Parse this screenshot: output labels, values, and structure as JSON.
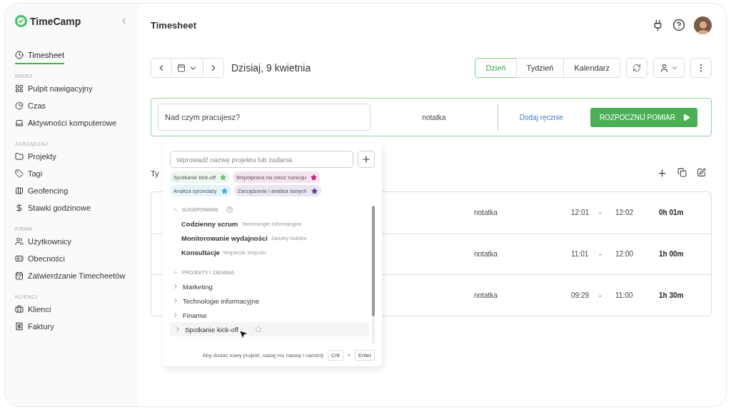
{
  "sidebar": {
    "logo": "TimeCamp",
    "nav": [
      {
        "label": "Timesheet",
        "selected": true
      }
    ],
    "groups": [
      {
        "heading": "MIERZ",
        "items": [
          {
            "label": "Pulpit nawigacyjny",
            "selected": false
          },
          {
            "label": "Czas",
            "selected": false
          },
          {
            "label": "Aktywności komputerowe",
            "selected": false
          }
        ]
      },
      {
        "heading": "ZARZĄDZAJ",
        "items": [
          {
            "label": "Projekty",
            "selected": false
          },
          {
            "label": "Tagi",
            "selected": false
          },
          {
            "label": "Geofencing",
            "selected": false
          },
          {
            "label": "Stawki godzinowe",
            "selected": false
          }
        ]
      },
      {
        "heading": "FIRMA",
        "items": [
          {
            "label": "Użytkownicy",
            "selected": false
          },
          {
            "label": "Obecności",
            "selected": false
          },
          {
            "label": "Zatwierdzanie Timecheetów",
            "selected": false
          }
        ]
      },
      {
        "heading": "KLIENCI",
        "items": [
          {
            "label": "Klienci",
            "selected": false
          },
          {
            "label": "Faktury",
            "selected": false
          }
        ]
      }
    ]
  },
  "header": {
    "title": "Timesheet"
  },
  "toolbar": {
    "date": "Dzisiaj, 9 kwietnia",
    "views": [
      {
        "label": "Dzień",
        "selected": true
      },
      {
        "label": "Tydzień",
        "selected": false
      },
      {
        "label": "Kalendarz",
        "selected": false
      }
    ]
  },
  "entry": {
    "placeholder": "Nad czym pracujesz?",
    "note": "notatka",
    "manual_link": "Dodaj ręcznie",
    "start_button": "ROZPOCZNIJ POMIAR"
  },
  "section_label": "Ty",
  "rows": [
    {
      "note": "notatka",
      "start": "12:01",
      "dash": "-",
      "end": "12:02",
      "duration": "0h 01m"
    },
    {
      "note": "notatka",
      "start": "11:01",
      "dash": "-",
      "end": "12:00",
      "duration": "1h 00m"
    },
    {
      "note": "notatka",
      "start": "09:29",
      "dash": "-",
      "end": "11:00",
      "duration": "1h 30m"
    }
  ],
  "dropdown": {
    "placeholder": "Wprowadź nazwę projektu lub zadania",
    "pinned": [
      {
        "label": "Spotkanie kick-off",
        "color": "#6cc070"
      },
      {
        "label": "Współpraca na rzecz rozwoju",
        "color": "#b0287a"
      },
      {
        "label": "Analiza sprzedaży",
        "color": "#3aa8e0"
      },
      {
        "label": "Zarządzanie i analiza danych",
        "color": "#5a3fa0"
      }
    ],
    "suggested_heading": "SUGEROWANE",
    "suggested": [
      {
        "name": "Codzienny scrum",
        "project": "Technologie informacyjne"
      },
      {
        "name": "Monitorowanie wydajności",
        "project": "Zasoby ludzkie"
      },
      {
        "name": "Konsultacje",
        "project": "Wsparcie zespołu"
      }
    ],
    "projects_heading": "PROJEKTY I ZADANIA",
    "projects": [
      {
        "label": "Marketing",
        "selected": false
      },
      {
        "label": "Technologie informacyjne",
        "selected": false
      },
      {
        "label": "Finanse",
        "selected": false
      },
      {
        "label": "Spotkanie kick-off",
        "selected": true
      }
    ],
    "footer_hint": "Aby dodać nowy projekt, nadaj mu nazwę i naciśnij",
    "keys": [
      "Crtl",
      "+",
      "Enter"
    ]
  }
}
